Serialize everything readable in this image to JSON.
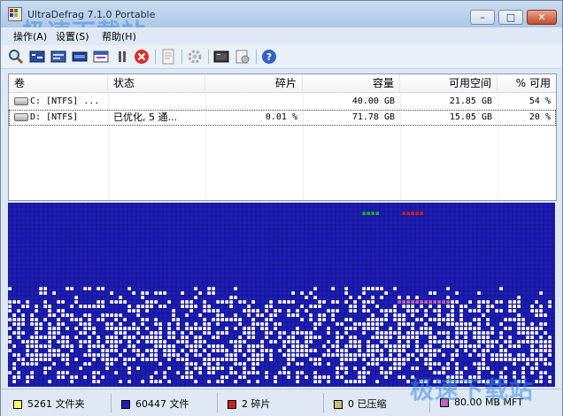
{
  "window": {
    "title": "UltraDefrag 7.1.0 Portable",
    "watermark": "极速下载站"
  },
  "menu": {
    "items": [
      "操作(A)",
      "设置(S)",
      "帮助(H)"
    ]
  },
  "toolbar": {
    "buttons": [
      "analyze-icon",
      "defrag-icon",
      "quick-optimize-icon",
      "full-optimize-icon",
      "mft-optimize-icon",
      "pause-icon",
      "stop-icon",
      "report-icon",
      "settings-icon",
      "boot-time-icon",
      "boot-script-icon",
      "help-icon"
    ]
  },
  "volumes": {
    "columns": [
      "卷",
      "状态",
      "碎片",
      "容量",
      "可用空间",
      "% 可用"
    ],
    "rows": [
      {
        "volume": "C: [NTFS]  ...",
        "status": "",
        "fragmentation": "",
        "capacity": "40.00 GB",
        "free": "21.85 GB",
        "percent_free": "54 %"
      },
      {
        "volume": "D: [NTFS]",
        "status": "已优化, 5 通...",
        "fragmentation": "0.01 %",
        "capacity": "71.78 GB",
        "free": "15.05 GB",
        "percent_free": "20 %"
      }
    ]
  },
  "status": {
    "folders": "5261 文件夹",
    "files": "60447 文件",
    "fragmented": "2 碎片",
    "compressed": "0 已压缩",
    "mft": "80.00 MB MFT"
  },
  "colors": {
    "free": "#1e1eb4",
    "used": "#ffffff",
    "fragmented": "#cc2020",
    "folder": "#ffff66",
    "mft": "#c060c0",
    "system": "#22aa22"
  }
}
